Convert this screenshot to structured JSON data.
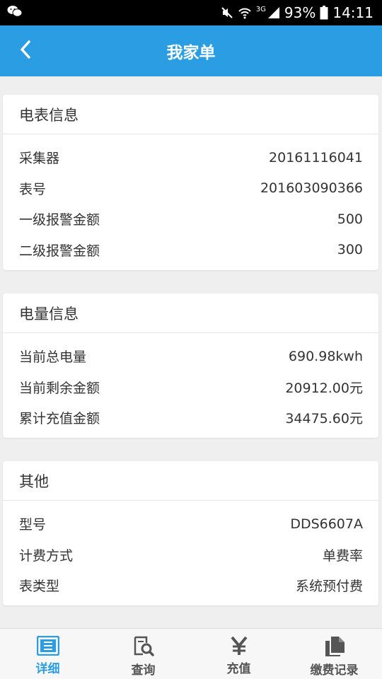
{
  "status_bar": {
    "battery": "93%",
    "time": "14:11",
    "network": "3G",
    "icons": [
      "wechat-icon",
      "mute-icon",
      "wifi-icon",
      "signal-icon",
      "battery-icon"
    ]
  },
  "header": {
    "title": "我家单",
    "back_icon": "chevron-left-icon"
  },
  "meter_info": {
    "title": "电表信息",
    "rows": [
      {
        "label": "采集器",
        "value": "20161116041"
      },
      {
        "label": "表号",
        "value": "201603090366"
      },
      {
        "label": "一级报警金额",
        "value": "500"
      },
      {
        "label": "二级报警金额",
        "value": "300"
      }
    ]
  },
  "power_info": {
    "title": "电量信息",
    "rows": [
      {
        "label": "当前总电量",
        "value": "690.98kwh"
      },
      {
        "label": "当前剩余金额",
        "value": "20912.00元"
      },
      {
        "label": "累计充值金额",
        "value": "34475.60元"
      }
    ]
  },
  "other_info": {
    "title": "其他",
    "rows": [
      {
        "label": "型号",
        "value": "DDS6607A"
      },
      {
        "label": "计费方式",
        "value": "单费率"
      },
      {
        "label": "表类型",
        "value": "系统预付费"
      }
    ]
  },
  "bottom_nav": {
    "items": [
      {
        "label": "详细",
        "icon": "detail-icon",
        "active": true
      },
      {
        "label": "查询",
        "icon": "search-document-icon",
        "active": false
      },
      {
        "label": "充值",
        "icon": "yen-icon",
        "active": false
      },
      {
        "label": "缴费记录",
        "icon": "documents-icon",
        "active": false
      }
    ]
  },
  "colors": {
    "accent": "#2b9ee3",
    "background": "#efefef",
    "text": "#333333"
  }
}
